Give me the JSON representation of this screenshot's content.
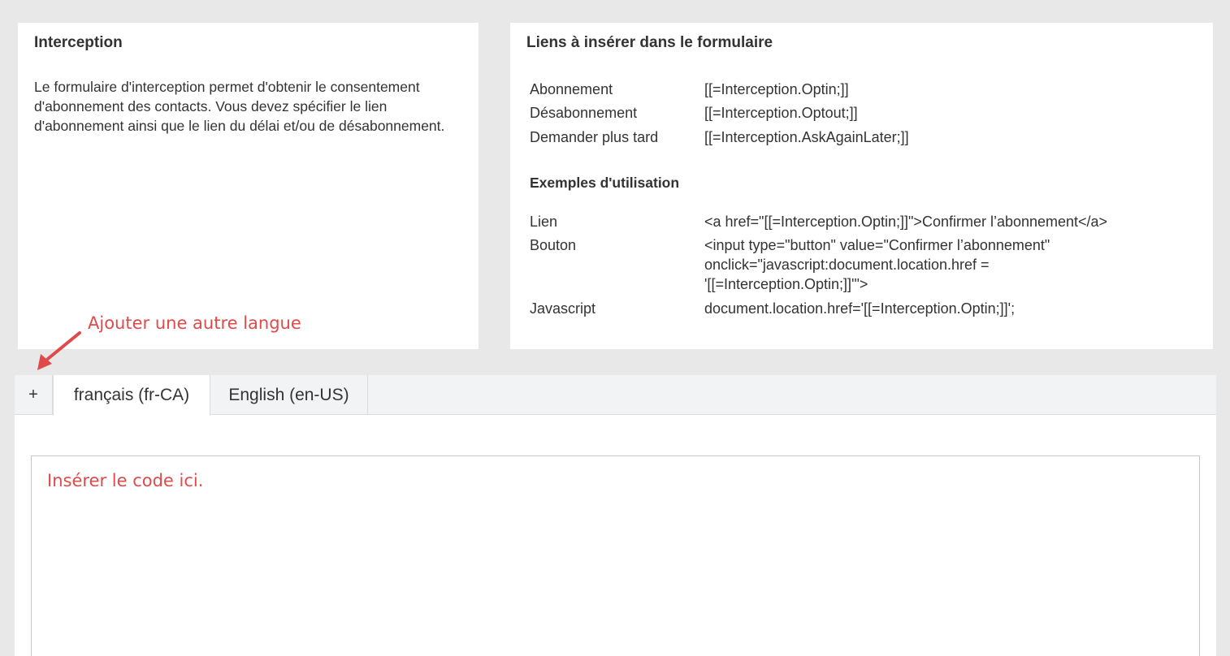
{
  "interception": {
    "title": "Interception",
    "description": "Le formulaire d'interception permet d'obtenir le consentement d'abonnement des contacts. Vous devez spécifier le lien d'abonnement ainsi que le lien du délai et/ou de désabonnement."
  },
  "links": {
    "title": "Liens à insérer dans le formulaire",
    "items": [
      {
        "label": "Abonnement",
        "value": "[[=Interception.Optin;]]"
      },
      {
        "label": "Désabonnement",
        "value": "[[=Interception.Optout;]]"
      },
      {
        "label": "Demander plus tard",
        "value": "[[=Interception.AskAgainLater;]]"
      }
    ],
    "examples_title": "Exemples d'utilisation",
    "examples": [
      {
        "label": "Lien",
        "value": "<a href=\"[[=Interception.Optin;]]\">Confirmer l’abonnement</a>"
      },
      {
        "label": "Bouton",
        "value": "<input type=\"button\" value=\"Confirmer l’abonnement\" onclick=\"javascript:document.location.href = '[[=Interception.Optin;]]'\">"
      },
      {
        "label": "Javascript",
        "value": "document.location.href='[[=Interception.Optin;]]';"
      }
    ]
  },
  "annotation": {
    "add_language": "Ajouter une autre langue",
    "color": "#e04a4a"
  },
  "tabs": {
    "add_label": "+",
    "items": [
      {
        "label": "français (fr-CA)",
        "active": true
      },
      {
        "label": "English (en-US)",
        "active": false
      }
    ]
  },
  "editor": {
    "placeholder_note": "Insérer le code ici."
  }
}
